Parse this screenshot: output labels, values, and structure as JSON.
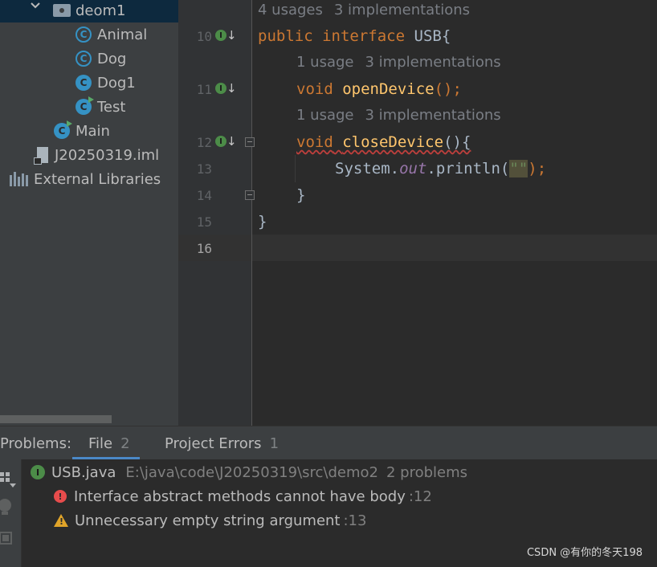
{
  "project_tree": {
    "items": [
      {
        "label": "deom1",
        "icon": "folder-icon"
      },
      {
        "label": "Animal",
        "icon": "abstract-class-icon"
      },
      {
        "label": "Dog",
        "icon": "abstract-class-icon"
      },
      {
        "label": "Dog1",
        "icon": "class-icon"
      },
      {
        "label": "Test",
        "icon": "runnable-class-icon"
      },
      {
        "label": "Main",
        "icon": "runnable-class-icon"
      },
      {
        "label": "J20250319.iml",
        "icon": "module-file-icon"
      },
      {
        "label": "External Libraries",
        "icon": "libraries-icon"
      }
    ]
  },
  "editor": {
    "line_numbers": [
      "10",
      "11",
      "12",
      "13",
      "14",
      "15",
      "16"
    ],
    "hints": [
      {
        "usages": "4 usages",
        "impl": "3 implementations"
      },
      {
        "usages": "1 usage",
        "impl": "3 implementations"
      },
      {
        "usages": "1 usage",
        "impl": "3 implementations"
      }
    ],
    "code": {
      "l10_kw1": "public",
      "l10_kw2": "interface",
      "l10_name": "USB{",
      "l11_kw": "void",
      "l11_fn": "openDevice",
      "l11_rest": "();",
      "l12_kw": "void",
      "l12_fn": "closeDevice",
      "l12_rest": "(){",
      "l13_a": "System.",
      "l13_field": "out",
      "l13_b": ".println(",
      "l13_str": "\"\"",
      "l13_c": ");",
      "l14": "}",
      "l15": "}"
    },
    "gutter_icon": "I"
  },
  "problems": {
    "title": "Problems:",
    "tabs": [
      {
        "label": "File",
        "count": "2"
      },
      {
        "label": "Project Errors",
        "count": "1"
      }
    ],
    "file": {
      "name": "USB.java",
      "path": "E:\\java\\code\\J20250319\\src\\demo2",
      "summary": "2 problems"
    },
    "items": [
      {
        "severity": "error",
        "message": "Interface abstract methods cannot have body",
        "line": ":12"
      },
      {
        "severity": "warning",
        "message": "Unnecessary empty string argument",
        "line": ":13"
      }
    ]
  },
  "watermark": "CSDN @有你的冬天198",
  "colors": {
    "accent": "#4a88c7",
    "error": "#e74c4c",
    "warning": "#e0a429",
    "keyword": "#cc7832",
    "function": "#ffc66d"
  }
}
